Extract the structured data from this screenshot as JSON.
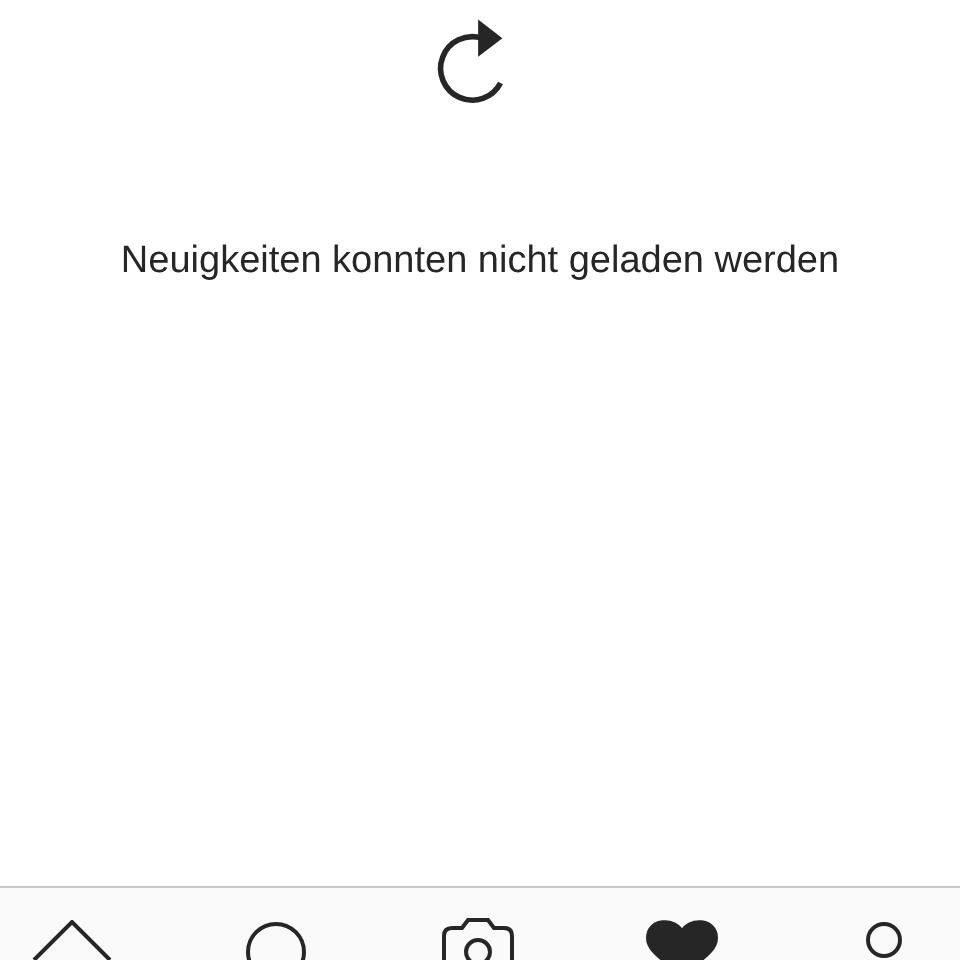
{
  "message": "Neuigkeiten konnten nicht geladen werden",
  "tabs": [
    {
      "kind": "home",
      "selected": false
    },
    {
      "kind": "search",
      "selected": false
    },
    {
      "kind": "camera",
      "selected": false
    },
    {
      "kind": "activity",
      "selected": true
    },
    {
      "kind": "profile",
      "selected": false
    }
  ]
}
